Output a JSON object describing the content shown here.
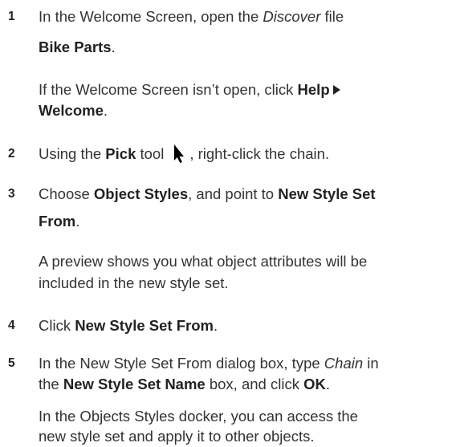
{
  "steps": [
    {
      "number": "1",
      "line1_pre": "In the Welcome Screen, open the ",
      "line1_em": "Discover",
      "line1_post": " file",
      "line2_b": "Bike Parts",
      "line2_post": ".",
      "note_line1_pre": "If the Welcome Screen isn’t open, click ",
      "note_line1_b": "Help",
      "note_line2_b": "Welcome",
      "note_line2_post": "."
    },
    {
      "number": "2",
      "pre": "Using the ",
      "b": "Pick",
      "mid": " tool",
      "post": ", right-click the chain.",
      "icon": "pick-tool-arrow-icon"
    },
    {
      "number": "3",
      "pre": "Choose ",
      "b1": "Object Styles",
      "mid": ", and point to ",
      "b2": "New Style Set",
      "line2_b": "From",
      "line2_post": ".",
      "note_line1": "A preview shows you what object attributes will be",
      "note_line2": "included in the new style set."
    },
    {
      "number": "4",
      "pre": "Click ",
      "b": "New Style Set From",
      "post": "."
    },
    {
      "number": "5",
      "line1_pre": "In the New Style Set From dialog box, type ",
      "line1_em": "Chain",
      "line1_post": " in",
      "line2_pre": "the ",
      "line2_b1": "New Style Set Name",
      "line2_mid": " box, and click ",
      "line2_b2": "OK",
      "line2_post": ".",
      "note_line1": "In the Objects Styles docker, you can access the",
      "note_line2": "new style set and apply it to other objects."
    }
  ],
  "colors": {
    "text": "#333333",
    "bold_text": "#222222",
    "background": "#ffffff"
  }
}
